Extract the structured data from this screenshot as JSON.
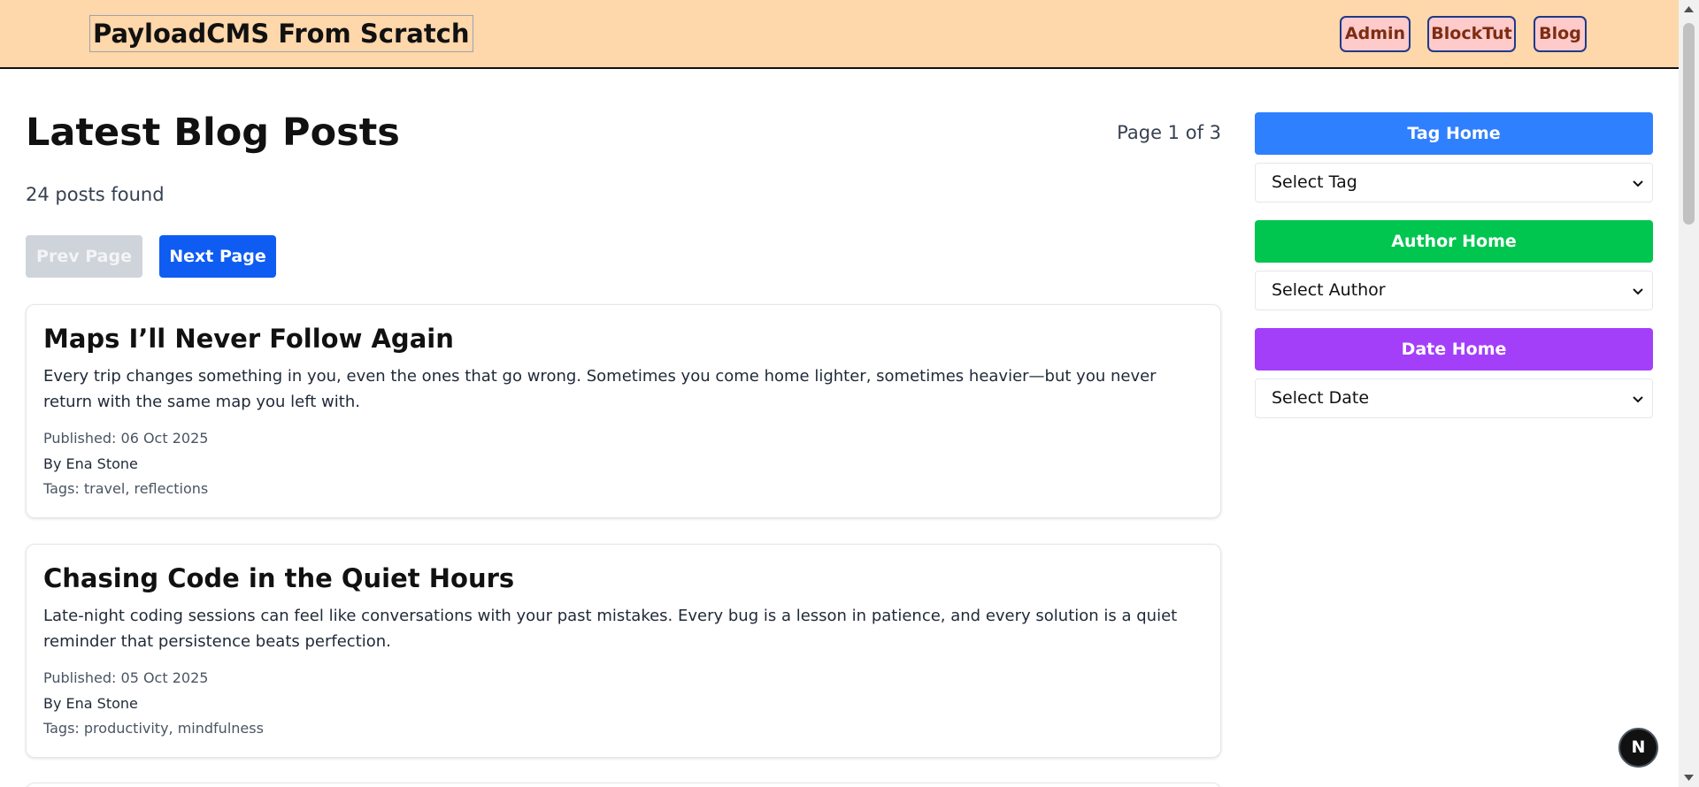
{
  "header": {
    "site_title": "PayloadCMS From Scratch",
    "nav": [
      {
        "label": "Admin"
      },
      {
        "label": "BlockTut"
      },
      {
        "label": "Blog"
      }
    ]
  },
  "main": {
    "heading": "Latest Blog Posts",
    "page_indicator": "Page 1 of 3",
    "posts_count": "24 posts found",
    "prev_label": "Prev Page",
    "next_label": "Next Page",
    "posts": [
      {
        "title": "Maps I’ll Never Follow Again",
        "excerpt": "Every trip changes something in you, even the ones that go wrong. Sometimes you come home lighter, sometimes heavier—but you never return with the same map you left with.",
        "published": "Published: 06 Oct 2025",
        "author": "By Ena Stone",
        "tags": "Tags: travel, reflections"
      },
      {
        "title": "Chasing Code in the Quiet Hours",
        "excerpt": "Late-night coding sessions can feel like conversations with your past mistakes. Every bug is a lesson in patience, and every solution is a quiet reminder that persistence beats perfection.",
        "published": "Published: 05 Oct 2025",
        "author": "By Ena Stone",
        "tags": "Tags: productivity, mindfulness"
      }
    ]
  },
  "sidebar": {
    "tag_home": "Tag Home",
    "tag_select": "Select Tag",
    "author_home": "Author Home",
    "author_select": "Select Author",
    "date_home": "Date Home",
    "date_select": "Select Date"
  },
  "colors": {
    "header_bg": "#fed7aa",
    "tag_home": "#2f80ff",
    "author_home": "#00c54f",
    "date_home": "#a43ff9",
    "next_button": "#0f5cf2"
  },
  "dev_badge": "N"
}
